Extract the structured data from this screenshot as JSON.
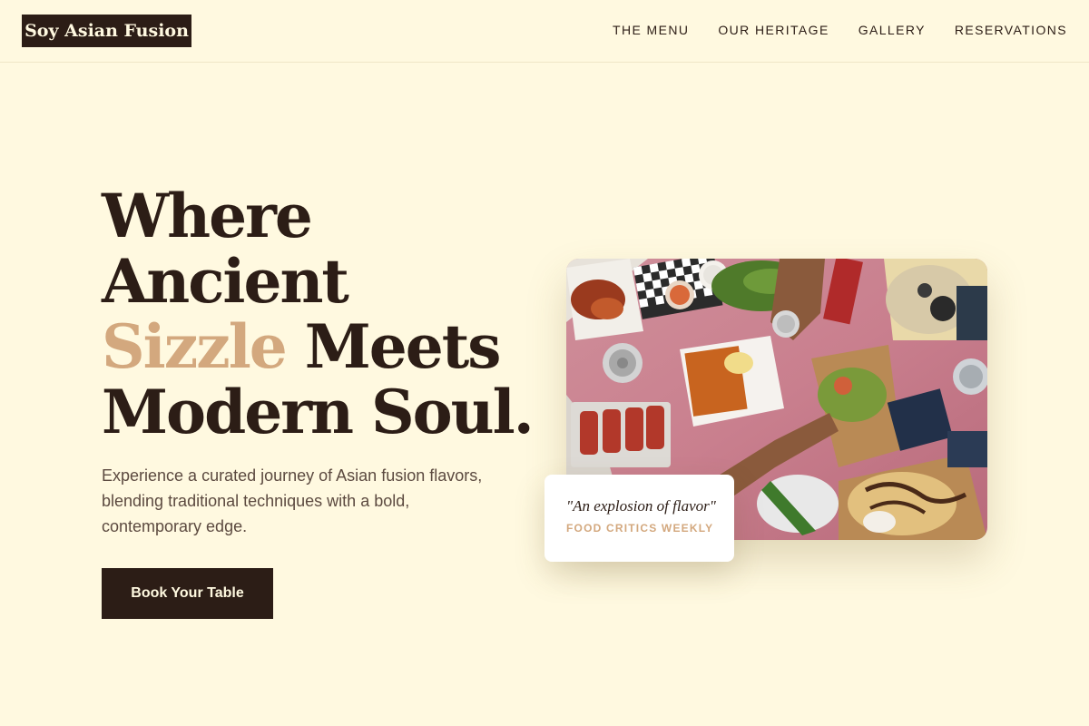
{
  "brand": {
    "name": "Soy Asian Fusion"
  },
  "nav": {
    "items": [
      {
        "label": "THE MENU"
      },
      {
        "label": "OUR HERITAGE"
      },
      {
        "label": "GALLERY"
      },
      {
        "label": "RESERVATIONS"
      }
    ]
  },
  "hero": {
    "headline": {
      "line1": "Where",
      "line2": "Ancient",
      "accent_word": "Sizzle",
      "line3_rest": " Meets",
      "line4": "Modern Soul."
    },
    "subtext": "Experience a curated journey of Asian fusion flavors, blending traditional techniques with a bold, contemporary edge.",
    "cta_label": "Book Your Table"
  },
  "testimonial": {
    "quote": "\"An explosion of flavor\"",
    "source": "FOOD CRITICS WEEKLY"
  },
  "colors": {
    "background": "#fff9e0",
    "primary_dark": "#2c1d16",
    "accent": "#d3a87e",
    "body_text": "#5c4a40"
  },
  "icons": {
    "hero_image": "food-spread-photo"
  }
}
